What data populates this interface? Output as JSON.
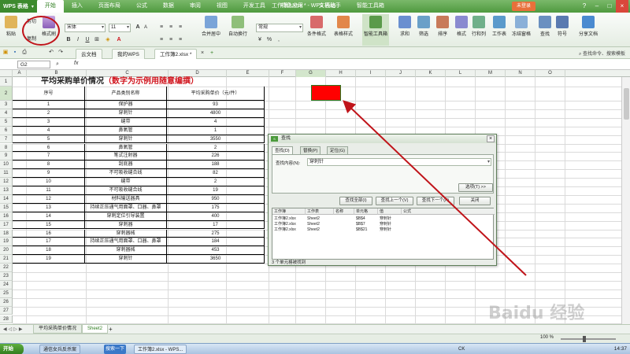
{
  "titlebar": {
    "app_name": "WPS 表格",
    "menus": [
      "开始",
      "插入",
      "页面布局",
      "公式",
      "数据",
      "审阅",
      "视图",
      "开发工具",
      "特色应用",
      "文档助手",
      "智能工具箱"
    ],
    "doc_title": "工作簿2.xlsx * - WPS 表格",
    "login_label": "未登录"
  },
  "ribbon": {
    "paste": "粘贴",
    "cut": "剪切",
    "copy": "复制",
    "format_painter": "格式刷",
    "font_name": "宋体",
    "font_size": "11",
    "merge_center": "合并居中",
    "auto_wrap": "自动换行",
    "number_format": "常规",
    "conditional_format": "条件格式",
    "table_style": "表格样式",
    "smart_toolbox": "智能工具箱",
    "sum": "求和",
    "filter": "筛选",
    "sort": "排序",
    "format": "格式",
    "rows_cols": "行和列",
    "worksheet": "工作表",
    "freeze": "冻结窗格",
    "find": "查找",
    "symbol": "符号",
    "share": "分享文档"
  },
  "doc_tabs": {
    "items": [
      "云文档",
      "我的WPS",
      "工作簿2.xlsx *"
    ],
    "right_text": "查找命令、搜索模板"
  },
  "formula_bar": {
    "cell_ref": "G2",
    "fx": "fx"
  },
  "sheet": {
    "columns": [
      "A",
      "B",
      "C",
      "D",
      "E",
      "F",
      "G",
      "H",
      "I",
      "J",
      "K",
      "L",
      "M",
      "N",
      "O"
    ],
    "title_black": "平均采购单价情况",
    "title_red": "（数字为示例用随意编撰）",
    "headers": [
      "序号",
      "产品类别名称",
      "平均采购单价（元/件）"
    ],
    "rows": [
      [
        "1",
        "保护器",
        "93"
      ],
      [
        "2",
        "穿刺针",
        "4800"
      ],
      [
        "3",
        "缝带",
        "4"
      ],
      [
        "4",
        "鼻氧管",
        "1"
      ],
      [
        "5",
        "穿刺针",
        "3550"
      ],
      [
        "6",
        "鼻氧管",
        "2"
      ],
      [
        "7",
        "笔式注射器",
        "226"
      ],
      [
        "8",
        "刮底器",
        "188"
      ],
      [
        "9",
        "不可吸收缝合线",
        "82"
      ],
      [
        "10",
        "缝带",
        "2"
      ],
      [
        "11",
        "不可吸收缝合线",
        "19"
      ],
      [
        "12",
        "材料输送器具",
        "950"
      ],
      [
        "13",
        "持续正压通气用面罩、口器、鼻罩",
        "175"
      ],
      [
        "14",
        "穿刺定位引导装置",
        "400"
      ],
      [
        "15",
        "穿刺器",
        "17"
      ],
      [
        "16",
        "穿刺器械",
        "275"
      ],
      [
        "17",
        "持续正压通气用面罩、口器、鼻罩",
        "184"
      ],
      [
        "18",
        "穿刺器械",
        "453"
      ],
      [
        "19",
        "穿刺针",
        "3650"
      ]
    ]
  },
  "find_dialog": {
    "title": "查找",
    "tabs": [
      "查找(D)",
      "替换(P)",
      "定位(G)"
    ],
    "find_label": "查找内容(N):",
    "find_value": "穿刺针",
    "options_btn": "选项(T) >>",
    "find_all_btn": "查找全部(I)",
    "find_prev_btn": "查找上一个(V)",
    "find_next_btn": "查找下一个(F)",
    "close_btn": "关闭",
    "result_headers": [
      "工作簿",
      "工作表",
      "名称",
      "单元格",
      "值",
      "公式"
    ],
    "results": [
      [
        "工作簿2.xlsx",
        "Sheet2",
        "",
        "$B$4",
        "穿刺针",
        ""
      ],
      [
        "工作簿2.xlsx",
        "Sheet2",
        "",
        "$B$7",
        "穿刺针",
        ""
      ],
      [
        "工作簿2.xlsx",
        "Sheet2",
        "",
        "$B$21",
        "穿刺针",
        ""
      ]
    ],
    "status": "3 个单元格被找到"
  },
  "sheet_tabs": [
    "平均采购单价情况",
    "Sheet2"
  ],
  "statusbar": {
    "zoom": "100 %"
  },
  "taskbar": {
    "start": "开始",
    "task1": "通信女兵反杀案",
    "search": "搜索一下",
    "task2": "工作簿2.xlsx - WPS...",
    "ime": "CK",
    "time": "14:37"
  },
  "watermark": "Baidu 经验",
  "colors": {
    "accent_green": "#4f9a3f",
    "highlight_red": "#ff0000",
    "annotation_red": "#c0141a"
  }
}
